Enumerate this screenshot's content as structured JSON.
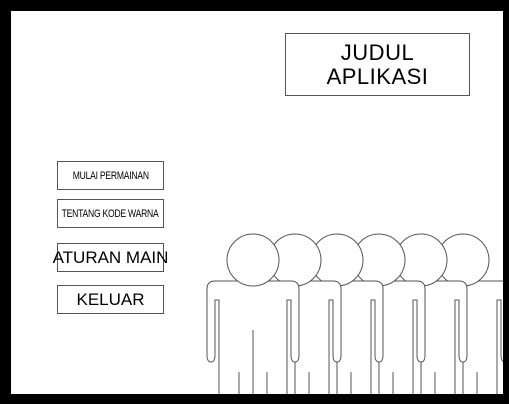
{
  "app": {
    "title_lines": [
      "JUDUL",
      "APLIKASI"
    ]
  },
  "menu": {
    "items": [
      {
        "id": "start",
        "label": "MULAI PERMAINAN"
      },
      {
        "id": "about",
        "label": "TENTANG KODE WARNA"
      },
      {
        "id": "rules",
        "label": "ATURAN MAIN"
      },
      {
        "id": "exit",
        "label": "KELUAR"
      }
    ]
  },
  "illustration": {
    "name": "people-group-icon",
    "figure_count": 6,
    "stroke_color": "#555555",
    "background": "#ffffff"
  },
  "colors": {
    "frame": "#000000",
    "box_border": "#555555",
    "text": "#000000"
  }
}
